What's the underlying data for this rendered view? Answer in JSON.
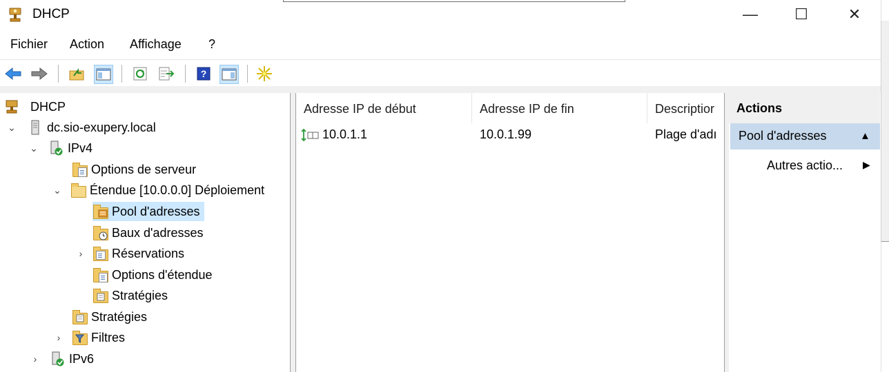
{
  "window": {
    "title": "DHCP",
    "minimize": "—",
    "maximize": "☐",
    "close": "✕"
  },
  "menu": [
    "Fichier",
    "Action",
    "Affichage",
    "?"
  ],
  "tree": {
    "root": "DHCP",
    "server": "dc.sio-exupery.local",
    "ipv4": "IPv4",
    "server_options": "Options de serveur",
    "scope": "Étendue [10.0.0.0] Déploiement",
    "pool": "Pool d'adresses",
    "leases": "Baux d'adresses",
    "reservations": "Réservations",
    "scope_options": "Options d'étendue",
    "scope_policies": "Stratégies",
    "policies": "Stratégies",
    "filters": "Filtres",
    "ipv6": "IPv6"
  },
  "list": {
    "columns": [
      "Adresse IP de début",
      "Adresse IP de fin",
      "Descriptior"
    ],
    "rows": [
      {
        "start": "10.0.1.1",
        "end": "10.0.1.99",
        "description": "Plage d'adı"
      }
    ]
  },
  "actions": {
    "title": "Actions",
    "section": "Pool d'adresses",
    "more": "Autres actio..."
  },
  "colors": {
    "selection": "#cce8ff",
    "action_section": "#c7d9ec",
    "panel_gray": "#f0f0f0"
  },
  "icons": [
    "back-arrow-icon",
    "forward-arrow-icon",
    "up-folder-icon",
    "show-hide-tree-icon",
    "refresh-icon",
    "export-list-icon",
    "help-icon",
    "show-hide-action-pane-icon",
    "new-star-icon"
  ]
}
